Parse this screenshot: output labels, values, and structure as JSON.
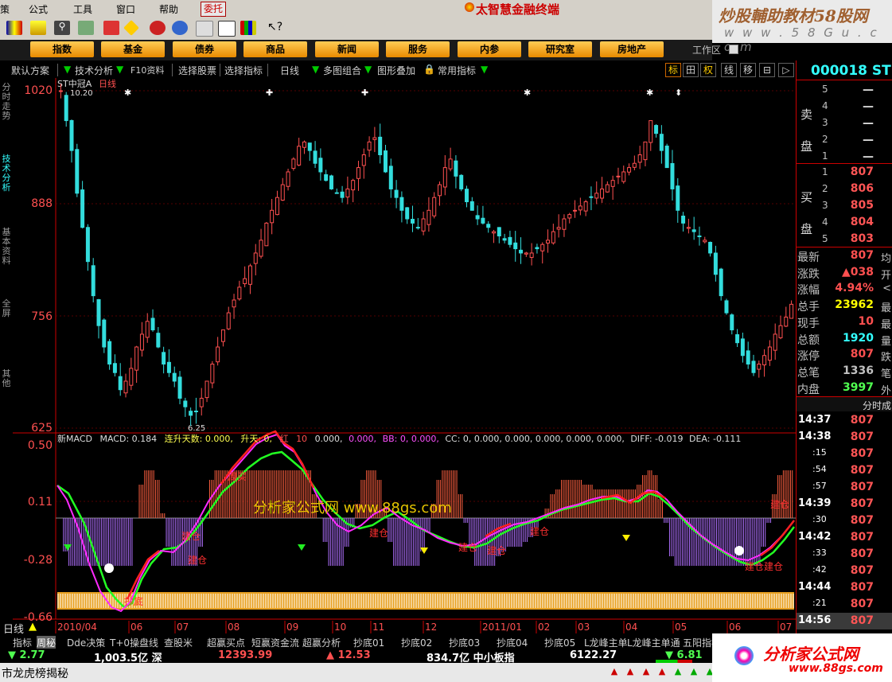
{
  "menu": {
    "items": [
      "策",
      "公式",
      "工具",
      "窗口",
      "帮助"
    ],
    "entrust": "委托",
    "app_title": "太智慧金融终端"
  },
  "watermark": {
    "site_text": "炒股輔助教材58股网",
    "site_url": "w w w . 5 8 G u . c o m",
    "center_text": "分析家公式网 www.88gs.com"
  },
  "nav": {
    "buttons": [
      "指数",
      "基金",
      "债券",
      "商品",
      "新闻",
      "服务",
      "内参",
      "研究室",
      "房地产"
    ],
    "workspace": "工作区"
  },
  "options": {
    "items": [
      "默认方案",
      "技术分析",
      "F10资料",
      "选择股票",
      "选择指标",
      "日线",
      "多图组合",
      "图形叠加",
      "常用指标"
    ],
    "view_buttons": [
      "标",
      "田",
      "权",
      "线",
      "移"
    ]
  },
  "left_tabs": [
    "分时走势",
    "技术分析",
    "基本资料",
    "全屏",
    "其他"
  ],
  "chart": {
    "stock_name": "ST中冠A",
    "period": "日线",
    "max_label": "10.20",
    "min_label": "6.25",
    "price_axis": [
      "1020",
      "888",
      "756",
      "625"
    ],
    "macd_axis": [
      "0.50",
      "0.11",
      "-0.28",
      "-0.66"
    ],
    "date_axis": [
      "2010/04",
      "06",
      "07",
      "08",
      "09",
      "10",
      "11",
      "12",
      "2011/01",
      "02",
      "03",
      "04",
      "05",
      "06",
      "07"
    ],
    "indicator_line": {
      "name": "新MACD",
      "macd": "MACD: 0.184",
      "days": "连升天数: 0.000,",
      "up": "升天: 0,",
      "hong": "红",
      "ten": "10",
      "v1": "0.000,",
      "v2": "0.000,",
      "bb": "BB: 0, 0.000,",
      "cc": "CC: 0, 0.000, 0.000, 0.000, 0.000, 0.000,",
      "diff": "DIFF: -0.019",
      "dea": "DEA: -0.111"
    },
    "signals": [
      "周买",
      "建仓",
      "抄底",
      "周买",
      "建仓",
      "建仓",
      "建仓",
      "建仓",
      "建仓",
      "建仓",
      "建仓",
      "建仓"
    ],
    "bottom_label": "日线"
  },
  "chart_data": {
    "type": "candlestick",
    "price_range": [
      625,
      1020
    ],
    "closes": [
      1020,
      985,
      950,
      900,
      860,
      820,
      780,
      745,
      720,
      700,
      690,
      670,
      680,
      695,
      720,
      735,
      750,
      740,
      720,
      700,
      690,
      680,
      660,
      650,
      640,
      645,
      660,
      680,
      700,
      720,
      740,
      760,
      775,
      790,
      800,
      815,
      830,
      845,
      865,
      880,
      895,
      910,
      925,
      940,
      955,
      960,
      950,
      935,
      925,
      915,
      905,
      900,
      895,
      905,
      915,
      930,
      945,
      960,
      965,
      945,
      925,
      905,
      895,
      880,
      870,
      865,
      860,
      870,
      880,
      895,
      910,
      930,
      940,
      920,
      905,
      890,
      880,
      870,
      865,
      860,
      855,
      850,
      845,
      840,
      835,
      830,
      830,
      830,
      835,
      840,
      845,
      855,
      860,
      870,
      875,
      880,
      885,
      890,
      895,
      900,
      905,
      910,
      915,
      920,
      925,
      930,
      935,
      945,
      960,
      985,
      970,
      950,
      930,
      905,
      880,
      865,
      860,
      855,
      850,
      845,
      830,
      805,
      780,
      760,
      740,
      725,
      710,
      700,
      690,
      700,
      710,
      720,
      735,
      745,
      755,
      770
    ]
  },
  "quote": {
    "code": "000018 ST",
    "sell_label": "卖盘",
    "buy_label": "买盘",
    "sell": [
      {
        "n": "5",
        "price": "—"
      },
      {
        "n": "4",
        "price": "—"
      },
      {
        "n": "3",
        "price": "—"
      },
      {
        "n": "2",
        "price": "—"
      },
      {
        "n": "1",
        "price": "—"
      }
    ],
    "buy": [
      {
        "n": "1",
        "price": "807"
      },
      {
        "n": "2",
        "price": "806"
      },
      {
        "n": "3",
        "price": "805"
      },
      {
        "n": "4",
        "price": "804"
      },
      {
        "n": "5",
        "price": "803"
      }
    ],
    "stats": [
      {
        "label": "最新",
        "value": "807",
        "x": "均",
        "color": "#ff5050"
      },
      {
        "label": "涨跌",
        "value": "▲038",
        "x": "开",
        "color": "#ff5050"
      },
      {
        "label": "涨幅",
        "value": "4.94%",
        "x": "<",
        "color": "#ff5050"
      },
      {
        "label": "总手",
        "value": "23962",
        "x": "最",
        "color": "#ffff00"
      },
      {
        "label": "现手",
        "value": "10",
        "x": "最",
        "color": "#ff5050"
      },
      {
        "label": "总额",
        "value": "1920",
        "x": "量",
        "color": "#3ff"
      },
      {
        "label": "涨停",
        "value": "807",
        "x": "跌",
        "color": "#ff5050"
      },
      {
        "label": "总笔",
        "value": "1336",
        "x": "笔",
        "color": "#c0c0c0"
      },
      {
        "label": "内盘",
        "value": "3997",
        "x": "外",
        "color": "#50ff50"
      }
    ],
    "ticks_title": "分时成",
    "ticks": [
      {
        "t": "14:37",
        "p": "807"
      },
      {
        "t": "14:38",
        "p": "807"
      },
      {
        "t": ":15",
        "p": "807"
      },
      {
        "t": ":54",
        "p": "807"
      },
      {
        "t": ":57",
        "p": "807"
      },
      {
        "t": "14:39",
        "p": "807"
      },
      {
        "t": ":30",
        "p": "807"
      },
      {
        "t": "14:42",
        "p": "807"
      },
      {
        "t": ":33",
        "p": "807"
      },
      {
        "t": ":42",
        "p": "807"
      },
      {
        "t": "14:44",
        "p": "807"
      },
      {
        "t": ":21",
        "p": "807"
      },
      {
        "t": "14:56",
        "p": "807"
      }
    ]
  },
  "bottom_tabs": [
    "指标",
    "周秘",
    "Dde决策",
    "T+0操盘线",
    "查股米",
    "超赢买点",
    "短赢资金流",
    "超赢分析",
    "抄底01",
    "抄底02",
    "抄底03",
    "抄底04",
    "抄底05",
    "L龙峰主单",
    "L龙峰主单通",
    "五阳指标"
  ],
  "ticker": [
    {
      "text": "▼ 2.77",
      "color": "#50ff50"
    },
    {
      "text": "1,003.5亿 深",
      "color": "#ffffff"
    },
    {
      "text": "12393.99",
      "color": "#ff5050"
    },
    {
      "text": "▲ 12.53",
      "color": "#ff5050"
    },
    {
      "text": "834.7亿 中小板指",
      "color": "#ffffff"
    },
    {
      "text": "6122.27",
      "color": "#ffffff"
    },
    {
      "text": "▼ 6.81",
      "color": "#50ff50"
    }
  ],
  "status": {
    "text": "市龙虎榜揭秘"
  },
  "ad_logo": {
    "name": "分析家公式网",
    "url": "www.88gs.com"
  }
}
